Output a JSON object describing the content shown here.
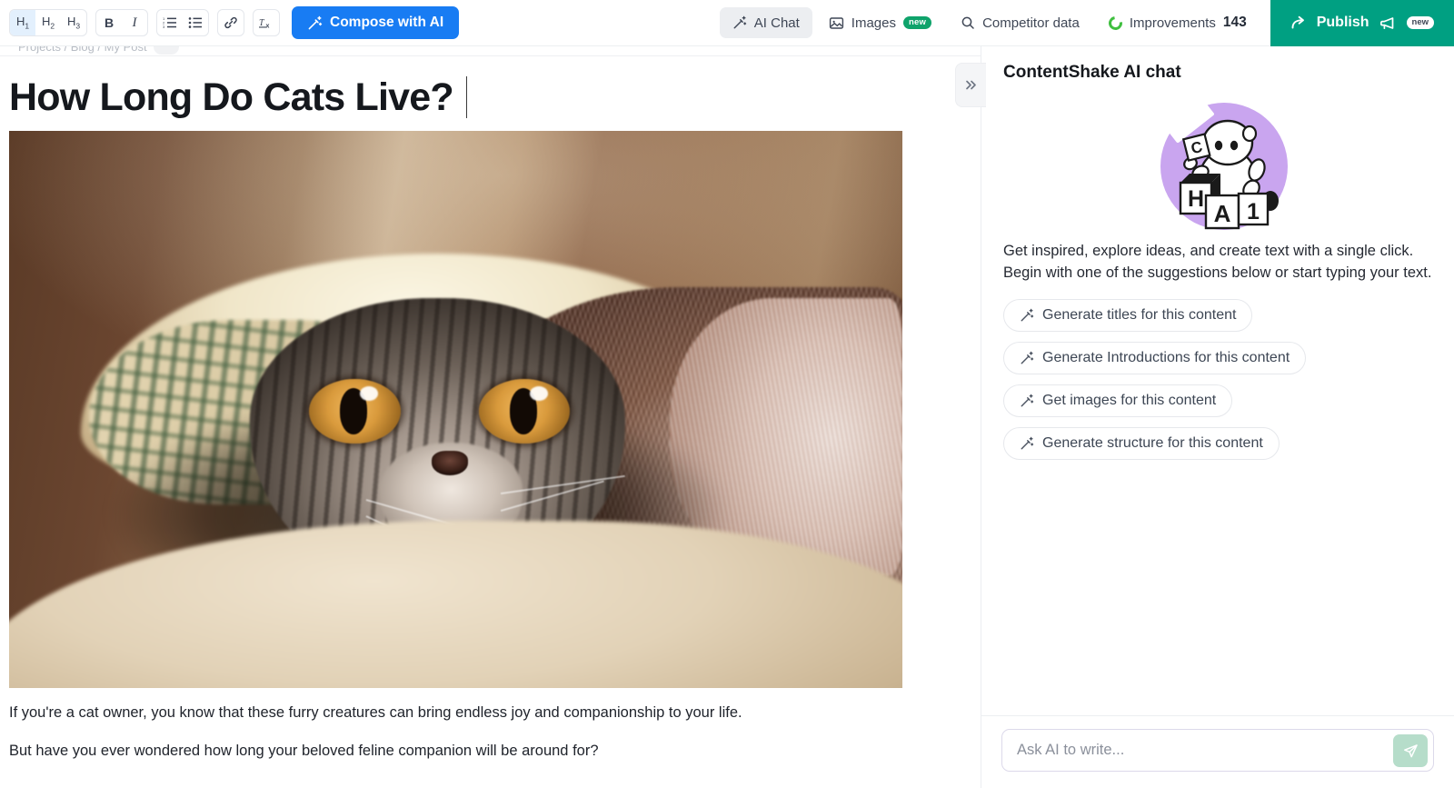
{
  "toolbar": {
    "format_groups": [
      {
        "name": "headings",
        "buttons": [
          {
            "label": "H",
            "sub": "1",
            "icon": "heading-1-icon",
            "active": true
          },
          {
            "label": "H",
            "sub": "2",
            "icon": "heading-2-icon",
            "active": false
          },
          {
            "label": "H",
            "sub": "3",
            "icon": "heading-3-icon",
            "active": false
          }
        ]
      },
      {
        "name": "style",
        "buttons": [
          {
            "label": "B",
            "icon": "bold-icon",
            "active": false
          },
          {
            "label": "I",
            "icon": "italic-icon",
            "active": false
          }
        ]
      },
      {
        "name": "lists",
        "buttons": [
          {
            "label": "",
            "icon": "ordered-list-icon",
            "active": false
          },
          {
            "label": "",
            "icon": "bullet-list-icon",
            "active": false
          }
        ]
      },
      {
        "name": "link",
        "buttons": [
          {
            "label": "",
            "icon": "link-icon",
            "active": false
          }
        ]
      },
      {
        "name": "clear",
        "buttons": [
          {
            "label": "",
            "icon": "clear-formatting-icon",
            "active": false
          }
        ]
      }
    ],
    "compose_label": "Compose with AI",
    "compose_icon": "magic-wand-icon",
    "compose_color": "#187cf3",
    "right_items": [
      {
        "label": "AI Chat",
        "icon": "magic-wand-icon",
        "active": true,
        "badge": ""
      },
      {
        "label": "Images",
        "icon": "image-icon",
        "active": false,
        "badge": "new"
      },
      {
        "label": "Competitor data",
        "icon": "search-icon",
        "active": false,
        "badge": ""
      }
    ],
    "improvements": {
      "label": "Improvements",
      "count": "143",
      "icon": "progress-ring-icon",
      "ring_color": "#3fbf3f"
    },
    "publish": {
      "label": "Publish",
      "icon": "share-arrow-icon",
      "badge": "new",
      "megaphone_icon": "megaphone-icon",
      "color": "#00a082"
    }
  },
  "editor": {
    "breadcrumb_cut": "Projects / Blog / My Post",
    "title": "How Long Do Cats Live?",
    "hero_image_alt": "Tabby cat peeking out from under a brown blanket on a sofa",
    "paragraphs": [
      "If you're a cat owner, you know that these furry creatures can bring endless joy and companionship to your life.",
      "But have you ever wondered how long your beloved feline companion will be around for?"
    ],
    "collapse_icon": "double-chevron-right-icon"
  },
  "chat": {
    "title": "ContentShake AI chat",
    "mascot_icon": "robot-mascot-icon",
    "mascot_blocks": [
      "C",
      "H",
      "A",
      "1"
    ],
    "mascot_circle_color": "#c9a5ef",
    "intro": "Get inspired, explore ideas, and create text with a single click. Begin with one of the suggestions below or start typing your text.",
    "suggestions": [
      {
        "label": "Generate titles for this content",
        "icon": "magic-wand-icon"
      },
      {
        "label": "Generate Introductions for this content",
        "icon": "magic-wand-icon"
      },
      {
        "label": "Get images for this content",
        "icon": "magic-wand-icon"
      },
      {
        "label": "Generate structure for this content",
        "icon": "magic-wand-icon"
      }
    ],
    "input": {
      "value": "",
      "placeholder": "Ask AI to write...",
      "send_icon": "send-paper-plane-icon",
      "send_color": "#b6ddca"
    }
  }
}
